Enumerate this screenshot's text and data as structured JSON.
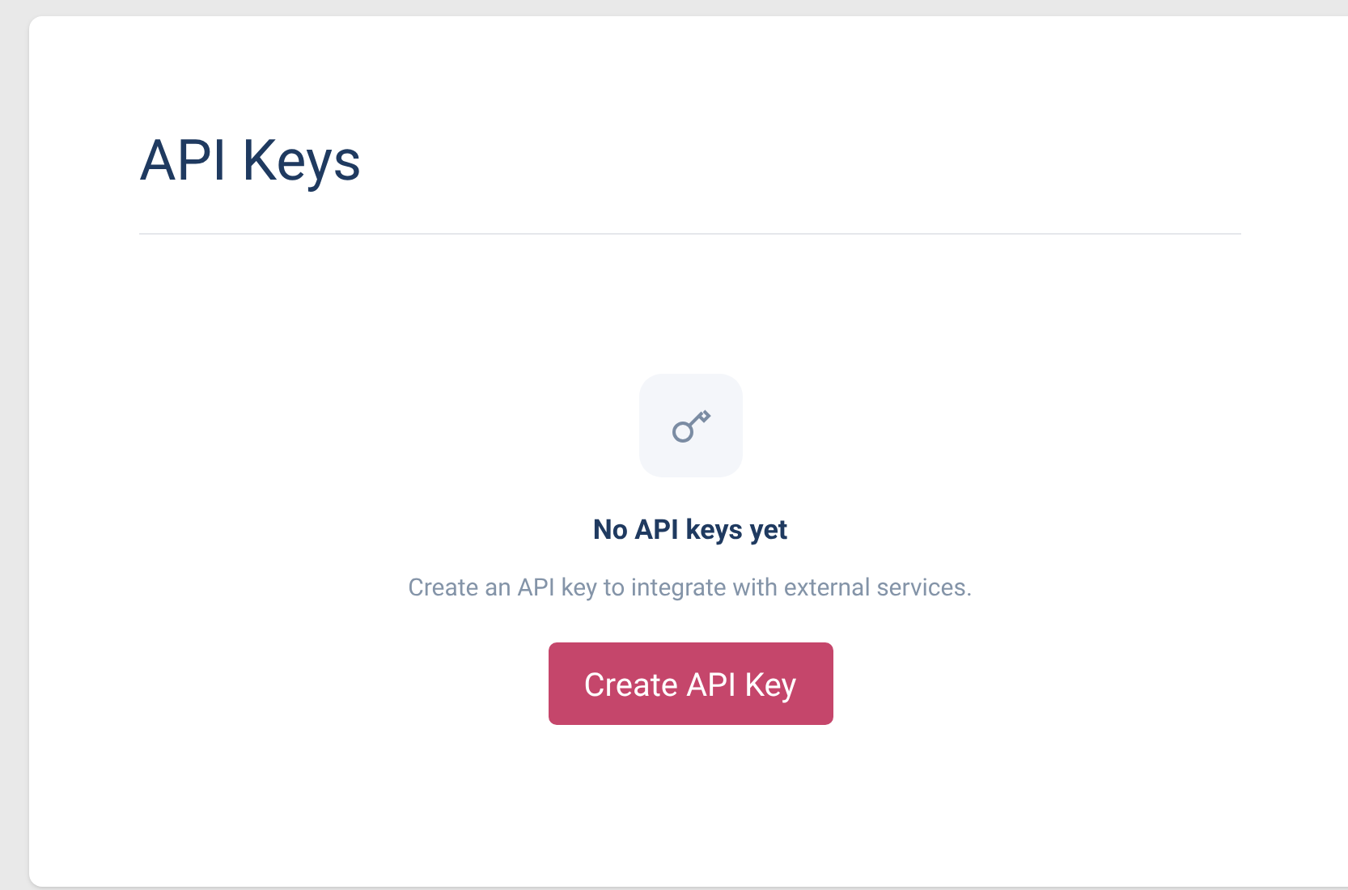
{
  "panel": {
    "title": "API Keys"
  },
  "empty_state": {
    "heading": "No API keys yet",
    "message": "Create an API key to integrate with external services.",
    "button": "Create API Key"
  }
}
